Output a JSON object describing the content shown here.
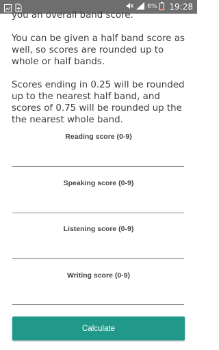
{
  "status_bar": {
    "battery_percent": "6%",
    "time": "19:28"
  },
  "content": {
    "paragraph_1_tail": "you an overall band score.",
    "paragraph_2": "You can be given a half band score as well, so scores are rounded up to whole or half bands.",
    "paragraph_3": "Scores ending in 0.25 will be rounded up to the nearest half band, and scores of 0.75 will be rounded up the the nearest whole band."
  },
  "fields": {
    "reading_label": "Reading score (0-9)",
    "speaking_label": "Speaking score (0-9)",
    "listening_label": "Listening score (0-9)",
    "writing_label": "Writing score (0-9)"
  },
  "button": {
    "calculate_label": "Calculate"
  },
  "colors": {
    "accent": "#21998a",
    "status_bar": "#6e6e6e"
  }
}
